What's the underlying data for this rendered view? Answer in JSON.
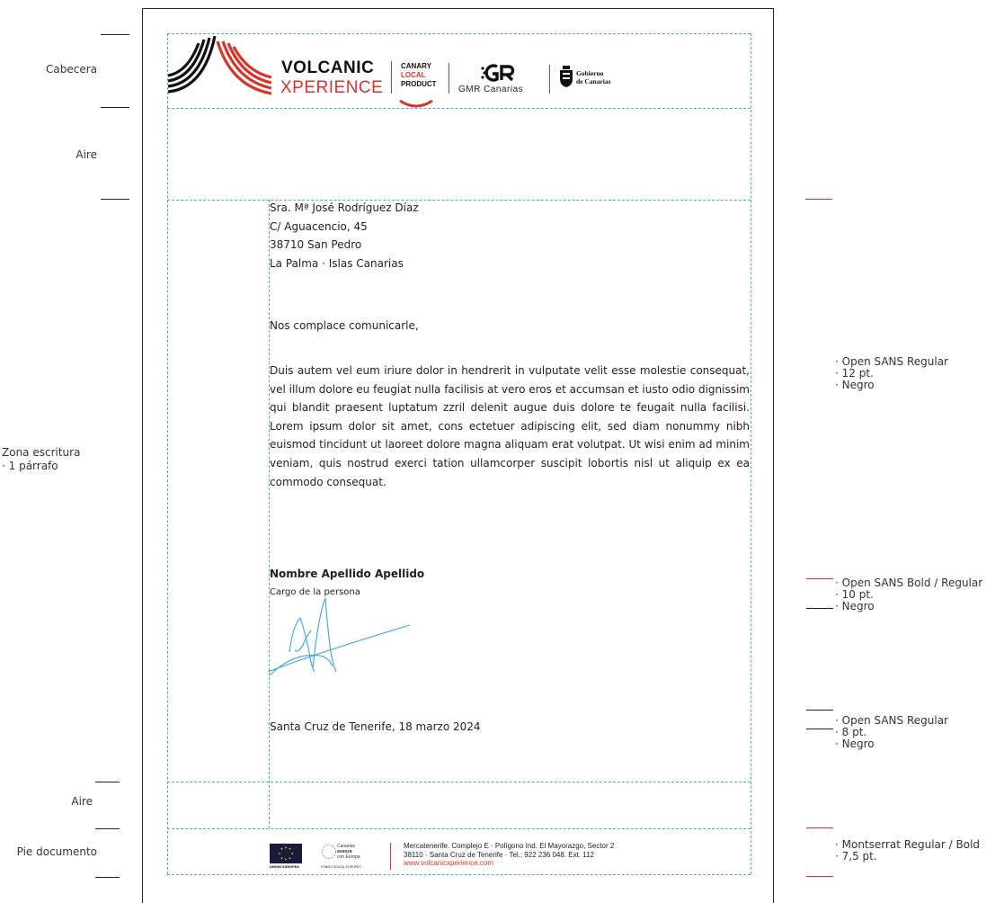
{
  "left_labels": {
    "cabecera": "Cabecera",
    "aire_top": "Aire",
    "zona_line1": "Zona escritura",
    "zona_line2": "· 1 párrafo",
    "aire_bottom": "Aire",
    "pie": "Pie documento"
  },
  "right_specs": {
    "spec1": [
      "· Open SANS Regular",
      "· 12 pt.",
      "· Negro"
    ],
    "spec2": [
      "· Open SANS Bold /  Regular",
      "· 10 pt.",
      "· Negro"
    ],
    "spec3": [
      "· Open SANS Regular",
      "· 8 pt.",
      "· Negro"
    ],
    "spec4": [
      "· Montserrat Regular / Bold",
      "· 7,5 pt."
    ]
  },
  "header": {
    "brand_line1": "VOLCANIC",
    "brand_line2": "XPERIENCE",
    "clp_canary": "CANARY",
    "clp_local": "LOCAL",
    "clp_product": "PRODUCT",
    "gmr": "GMR Canarias",
    "gobierno_line1": "Gobierno",
    "gobierno_line2": "de Canarias"
  },
  "address": {
    "name": "Sra. Mª José Rodríguez Díaz",
    "street": "C/ Aguacencio, 45",
    "city": "38710 San Pedro",
    "region": "La Palma · Islas Canarias"
  },
  "letter": {
    "greeting": "Nos complace comunicarle,",
    "paragraph": "Duis autem vel eum iriure dolor in hendrerit in vulputate velit esse molestie consequat, vel illum dolore eu feugiat nulla facilisis at vero eros et accumsan et iusto odio dignissim qui blandit praesent luptatum zzril delenit augue duis dolore te feugait nulla facilisi. Lorem ipsum dolor sit amet, cons ectetuer adipiscing elit, sed diam nonummy nibh euismod tincidunt ut laoreet dolore magna aliquam erat volutpat. Ut wisi enim ad minim veniam, quis nostrud exerci tation ullamcorper suscipit lobortis nisl ut aliquip ex ea commodo consequat.",
    "signer_name": "Nombre Apellido Apellido",
    "signer_role": "Cargo de la persona",
    "place_date": "Santa Cruz de Tenerife, 18 marzo 2024"
  },
  "footer": {
    "eu_label": "UNIÓN EUROPEA",
    "canarias_line1": "Canarias",
    "canarias_line2": "avanza",
    "canarias_line3": "con Europa",
    "fse_label": "FONDO SOCIAL EUROPEO",
    "address_line1": "Mercatenerife. Complejo E · Polígono Ind. El Mayorazgo, Sector 2",
    "address_line2": "38110 · Santa Cruz de Tenerife · Tel.: 922 236 048. Ext. 112",
    "url": "www.volcanicxperience.com"
  },
  "colors": {
    "guide_blue": "#4aa3df",
    "brand_red": "#d9342b",
    "text": "#222222",
    "eu_blue": "#1a1a3a"
  }
}
